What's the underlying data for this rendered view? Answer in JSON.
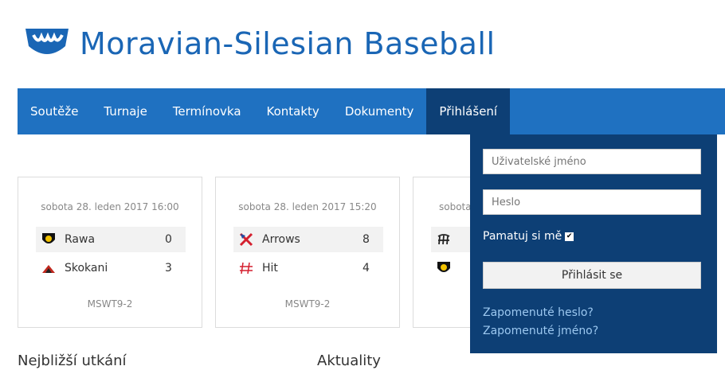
{
  "site": {
    "title": "Moravian-Silesian Baseball",
    "logo": "baseball-logo-icon"
  },
  "nav": {
    "items": [
      {
        "label": "Soutěže"
      },
      {
        "label": "Turnaje"
      },
      {
        "label": "Termínovka"
      },
      {
        "label": "Kontakty"
      },
      {
        "label": "Dokumenty"
      },
      {
        "label": "Přihlášení",
        "active": true
      }
    ]
  },
  "games": [
    {
      "date": "sobota 28. leden 2017 16:00",
      "home": {
        "name": "Rawa",
        "score": "0",
        "icon": "rawa-logo-icon"
      },
      "away": {
        "name": "Skokani",
        "score": "3",
        "icon": "skokani-logo-icon"
      },
      "league": "MSWT9-2"
    },
    {
      "date": "sobota 28. leden 2017 15:20",
      "home": {
        "name": "Arrows",
        "score": "8",
        "icon": "arrows-logo-icon"
      },
      "away": {
        "name": "Hit",
        "score": "4",
        "icon": "hit-logo-icon"
      },
      "league": "MSWT9-2"
    },
    {
      "date": "sobota",
      "home": {
        "name": "",
        "score": "",
        "icon": "team-logo-icon"
      },
      "away": {
        "name": "",
        "score": "",
        "icon": "rawa-logo-icon"
      },
      "league": ""
    }
  ],
  "login": {
    "username_placeholder": "Uživatelské jméno",
    "password_placeholder": "Heslo",
    "remember_label": "Pamatuj si mě",
    "remember_checked": true,
    "submit_label": "Přihlásit se",
    "forgot_password": "Zapomenuté heslo?",
    "forgot_username": "Zapomenuté jméno?"
  },
  "sections": {
    "nearest": "Nejbližší utkání",
    "news": "Aktuality"
  },
  "colors": {
    "brand": "#1a66b5",
    "nav": "#1f71c1",
    "nav_active": "#0d3f75",
    "link": "#9cc8f0"
  }
}
